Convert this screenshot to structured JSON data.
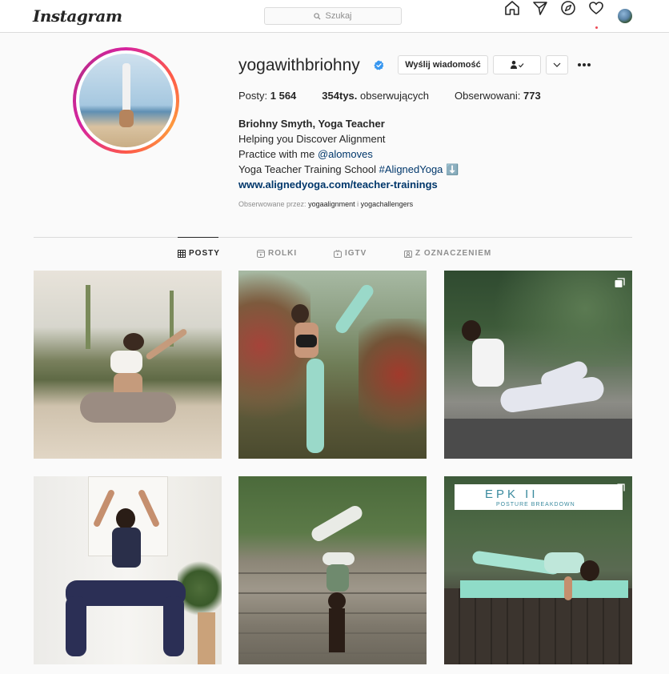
{
  "nav": {
    "logo": "Instagram",
    "search_placeholder": "Szukaj"
  },
  "profile": {
    "username": "yogawithbriohny",
    "message_button": "Wyślij wiadomość",
    "stats": {
      "posts_label": "Posty:",
      "posts_value": "1 564",
      "followers_value": "354tys.",
      "followers_label": "obserwujących",
      "following_label": "Obserwowani:",
      "following_value": "773"
    },
    "bio": {
      "name": "Briohny Smyth, Yoga Teacher",
      "line1": "Helping you Discover Alignment",
      "line2_prefix": "Practice with me ",
      "line2_mention": "@alomoves",
      "line3_prefix": "Yoga Teacher Training School ",
      "line3_hashtag": "#AlignedYoga",
      "line3_emoji": "⬇️",
      "url": "www.alignedyoga.com/teacher-trainings"
    },
    "followed_by": {
      "label": "Obserwowane przez:",
      "account1": "yogaalignment",
      "separator": " i ",
      "account2": "yogachallengers"
    }
  },
  "tabs": [
    {
      "label": "POSTY",
      "active": true
    },
    {
      "label": "ROLKI",
      "active": false
    },
    {
      "label": "IGTV",
      "active": false
    },
    {
      "label": "Z OZNACZENIEM",
      "active": false
    }
  ],
  "posts": [
    {
      "multi": false
    },
    {
      "multi": false
    },
    {
      "multi": true
    },
    {
      "multi": false
    },
    {
      "multi": false
    },
    {
      "multi": true,
      "overlay_title": "EPK II",
      "overlay_subtitle": "POSTURE BREAKDOWN"
    }
  ],
  "colors": {
    "accent_link": "#00376b",
    "verified": "#3897f0",
    "notification": "#ed4956"
  }
}
